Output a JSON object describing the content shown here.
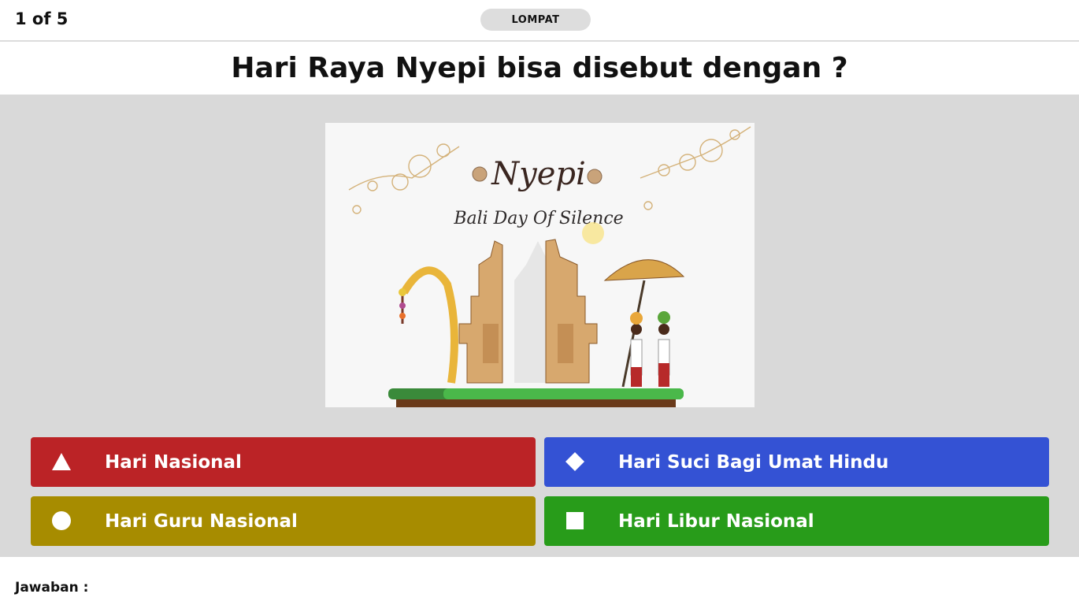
{
  "header": {
    "progress": "1 of 5",
    "skip_label": "LOMPAT"
  },
  "question": "Hari Raya Nyepi bisa disebut dengan ?",
  "media": {
    "title": "Nyepi",
    "subtitle": "Bali Day Of Silence"
  },
  "answers": [
    {
      "label": "Hari Nasional",
      "shape": "triangle-icon",
      "color": "#bb2326"
    },
    {
      "label": "Hari Suci Bagi Umat Hindu",
      "shape": "diamond-icon",
      "color": "#3452d4"
    },
    {
      "label": "Hari Guru Nasional",
      "shape": "circle-icon",
      "color": "#a78c00"
    },
    {
      "label": "Hari Libur Nasional",
      "shape": "square-icon",
      "color": "#289c1a"
    }
  ],
  "footer": {
    "answer_label": "Jawaban :"
  }
}
